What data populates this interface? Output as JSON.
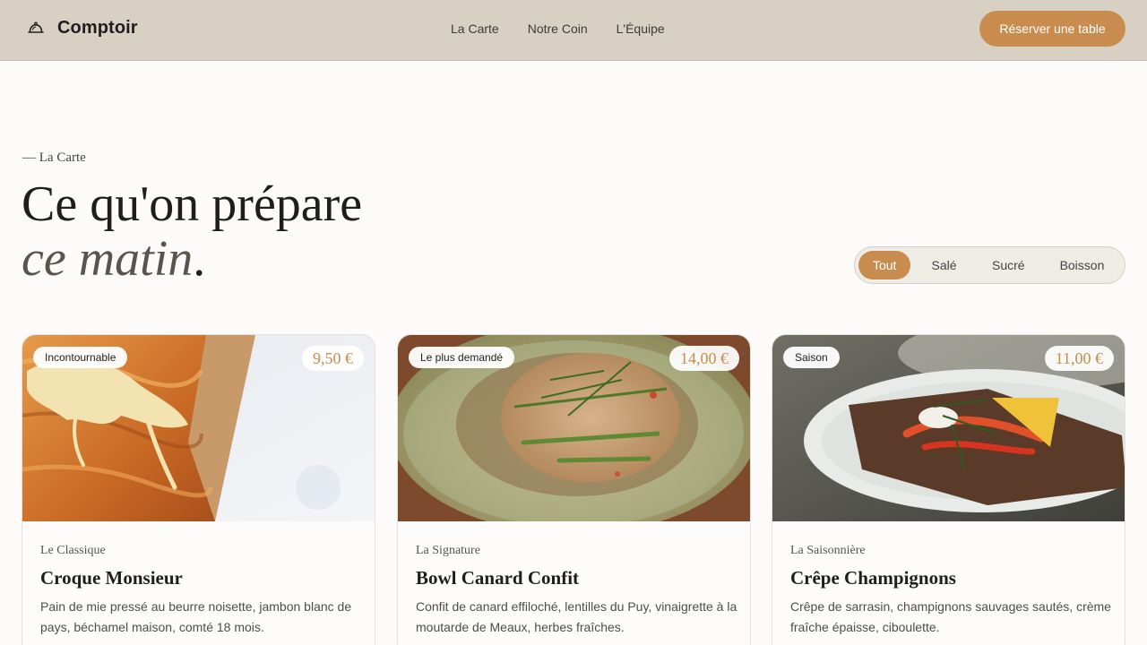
{
  "header": {
    "brand": "Comptoir",
    "brand_icon": "cloche-icon",
    "nav": [
      "La Carte",
      "Notre Coin",
      "L'Équipe"
    ],
    "cta": "Réserver une table"
  },
  "section": {
    "eyebrow": "— La Carte",
    "title_line1": "Ce qu'on prépare",
    "title_line2_italic": "ce matin",
    "title_line2_end": "."
  },
  "filters": {
    "items": [
      "Tout",
      "Salé",
      "Sucré",
      "Boisson"
    ],
    "active": "Tout"
  },
  "cards": [
    {
      "badge": "Incontournable",
      "price": "9,50 €",
      "kicker": "Le Classique",
      "title": "Croque Monsieur",
      "description": "Pain de mie pressé au beurre noisette, jambon blanc de pays, béchamel maison, comté 18 mois."
    },
    {
      "badge": "Le plus demandé",
      "price": "14,00 €",
      "kicker": "La Signature",
      "title": "Bowl Canard Confit",
      "description": "Confit de canard effiloché, lentilles du Puy, vinaigrette à la moutarde de Meaux, herbes fraîches."
    },
    {
      "badge": "Saison",
      "price": "11,00 €",
      "kicker": "La Saisonnière",
      "title": "Crêpe Champignons",
      "description": "Crêpe de sarrasin, champignons sauvages sautés, crème fraîche épaisse, ciboulette."
    }
  ],
  "colors": {
    "accent": "#c88d4e",
    "header_bg": "#d8d0c3",
    "page_bg": "#fcfbf9"
  }
}
